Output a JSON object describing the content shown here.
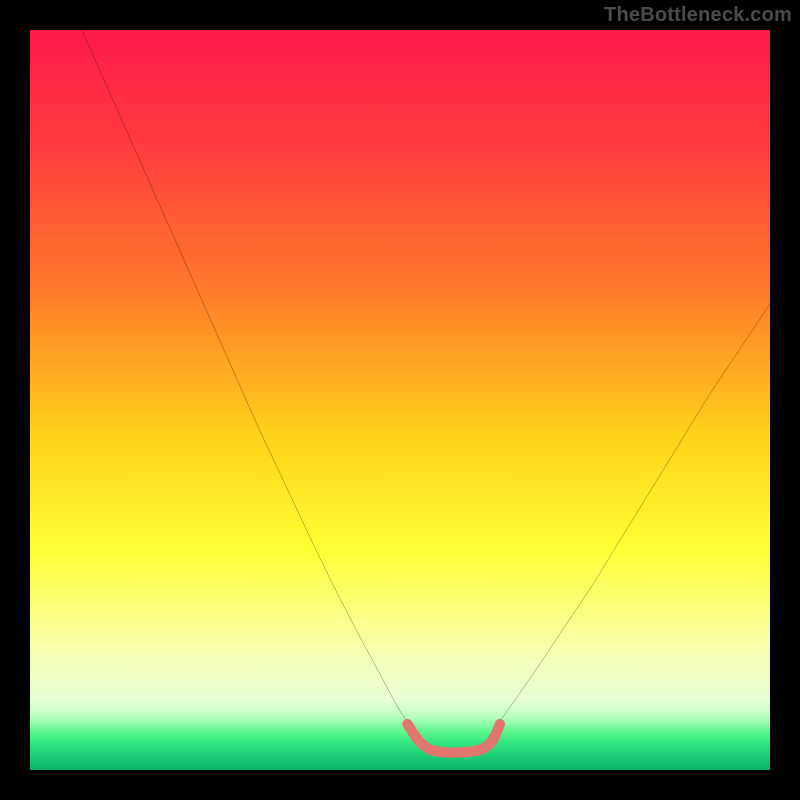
{
  "watermark": "TheBottleneck.com",
  "chart_data": {
    "type": "line",
    "title": "",
    "xlabel": "",
    "ylabel": "",
    "xlim": [
      0,
      100
    ],
    "ylim": [
      0,
      100
    ],
    "grid": false,
    "legend": false,
    "gradient_stops": [
      {
        "offset": 0.0,
        "color": "#ff1a4b"
      },
      {
        "offset": 0.15,
        "color": "#ff3a3f"
      },
      {
        "offset": 0.35,
        "color": "#ff7a2a"
      },
      {
        "offset": 0.55,
        "color": "#ffd21a"
      },
      {
        "offset": 0.7,
        "color": "#ffff33"
      },
      {
        "offset": 0.84,
        "color": "#f7ffb0"
      },
      {
        "offset": 0.905,
        "color": "#e8ffd6"
      },
      {
        "offset": 0.928,
        "color": "#b9ffc0"
      },
      {
        "offset": 0.95,
        "color": "#57f58a"
      },
      {
        "offset": 0.965,
        "color": "#2fe57e"
      },
      {
        "offset": 0.985,
        "color": "#18c873"
      },
      {
        "offset": 1.0,
        "color": "#0fb36a"
      }
    ],
    "series": [
      {
        "name": "bottleneck-curve-left",
        "color": "#000000",
        "x": [
          7.0,
          11.0,
          15.0,
          19.0,
          23.0,
          27.0,
          31.0,
          35.0,
          39.0,
          43.0,
          47.0,
          50.0,
          52.5
        ],
        "y": [
          100.0,
          91.0,
          82.0,
          73.0,
          64.0,
          55.0,
          46.0,
          37.5,
          29.0,
          21.0,
          13.5,
          8.0,
          4.5
        ]
      },
      {
        "name": "bottleneck-curve-right",
        "color": "#000000",
        "x": [
          62.0,
          64.5,
          68.0,
          72.0,
          76.0,
          80.0,
          84.0,
          88.0,
          92.0,
          96.0,
          100.0
        ],
        "y": [
          4.5,
          8.0,
          13.0,
          19.0,
          25.0,
          31.5,
          38.0,
          44.5,
          51.0,
          57.0,
          63.0
        ]
      },
      {
        "name": "optimal-band",
        "color": "#e2766f",
        "stroke_width": 10,
        "x": [
          51.0,
          52.5,
          54.0,
          56.0,
          58.5,
          61.0,
          62.5,
          63.5
        ],
        "y": [
          6.2,
          4.0,
          2.8,
          2.4,
          2.4,
          2.8,
          4.0,
          6.2
        ]
      }
    ]
  }
}
